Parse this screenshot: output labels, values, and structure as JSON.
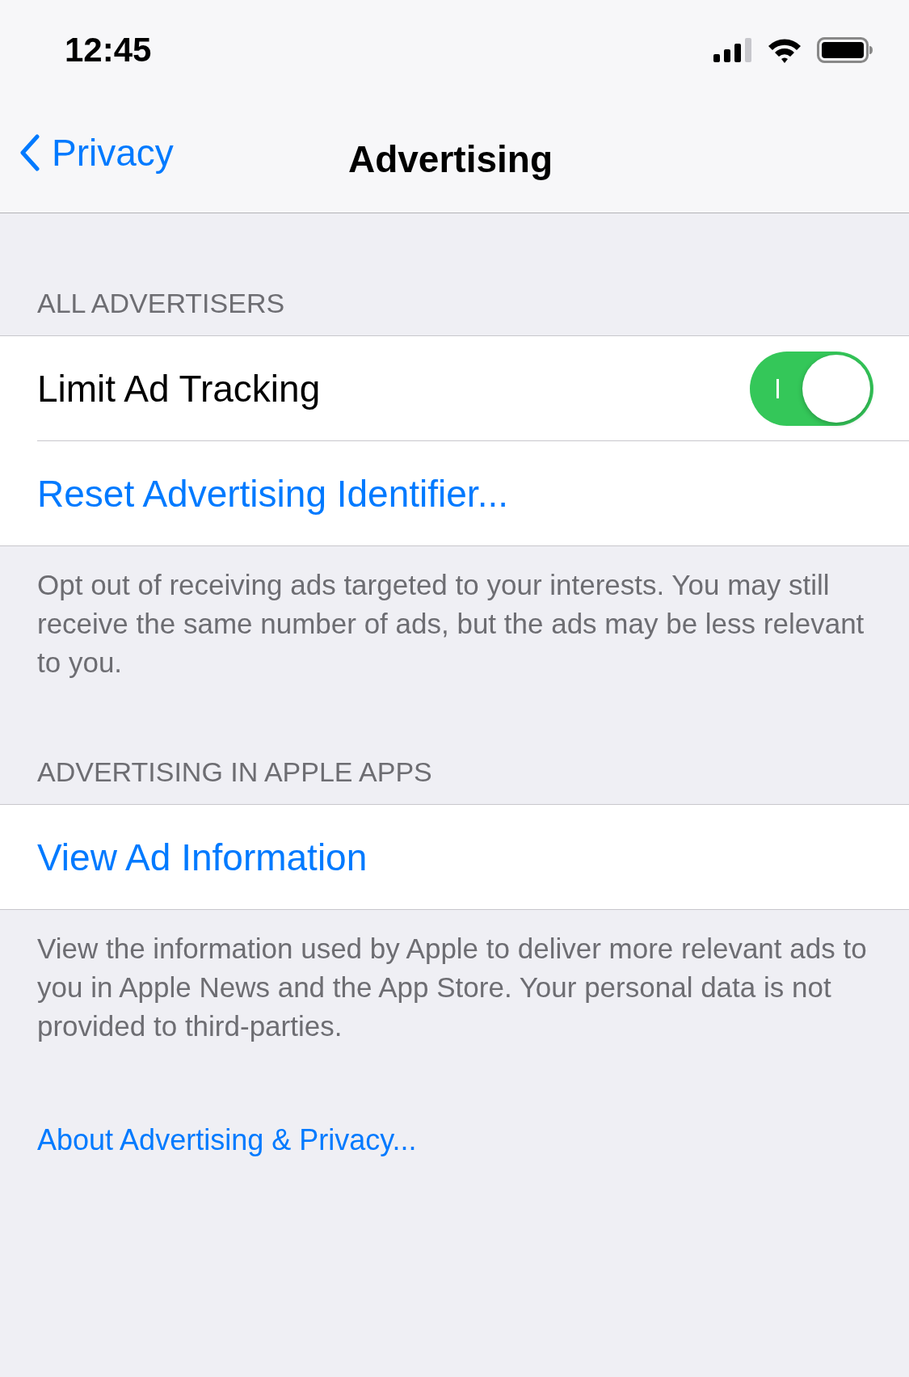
{
  "status_bar": {
    "time": "12:45"
  },
  "nav": {
    "back_label": "Privacy",
    "title": "Advertising"
  },
  "sections": [
    {
      "header": "ALL ADVERTISERS",
      "rows": [
        {
          "kind": "toggle",
          "label": "Limit Ad Tracking",
          "on": true
        },
        {
          "kind": "link",
          "label": "Reset Advertising Identifier..."
        }
      ],
      "footer": "Opt out of receiving ads targeted to your interests. You may still receive the same number of ads, but the ads may be less relevant to you."
    },
    {
      "header": "ADVERTISING IN APPLE APPS",
      "rows": [
        {
          "kind": "link",
          "label": "View Ad Information"
        }
      ],
      "footer": "View the information used by Apple to deliver more relevant ads to you in Apple News and the App Store. Your personal data is not provided to third-parties."
    }
  ],
  "about_link": "About Advertising & Privacy..."
}
